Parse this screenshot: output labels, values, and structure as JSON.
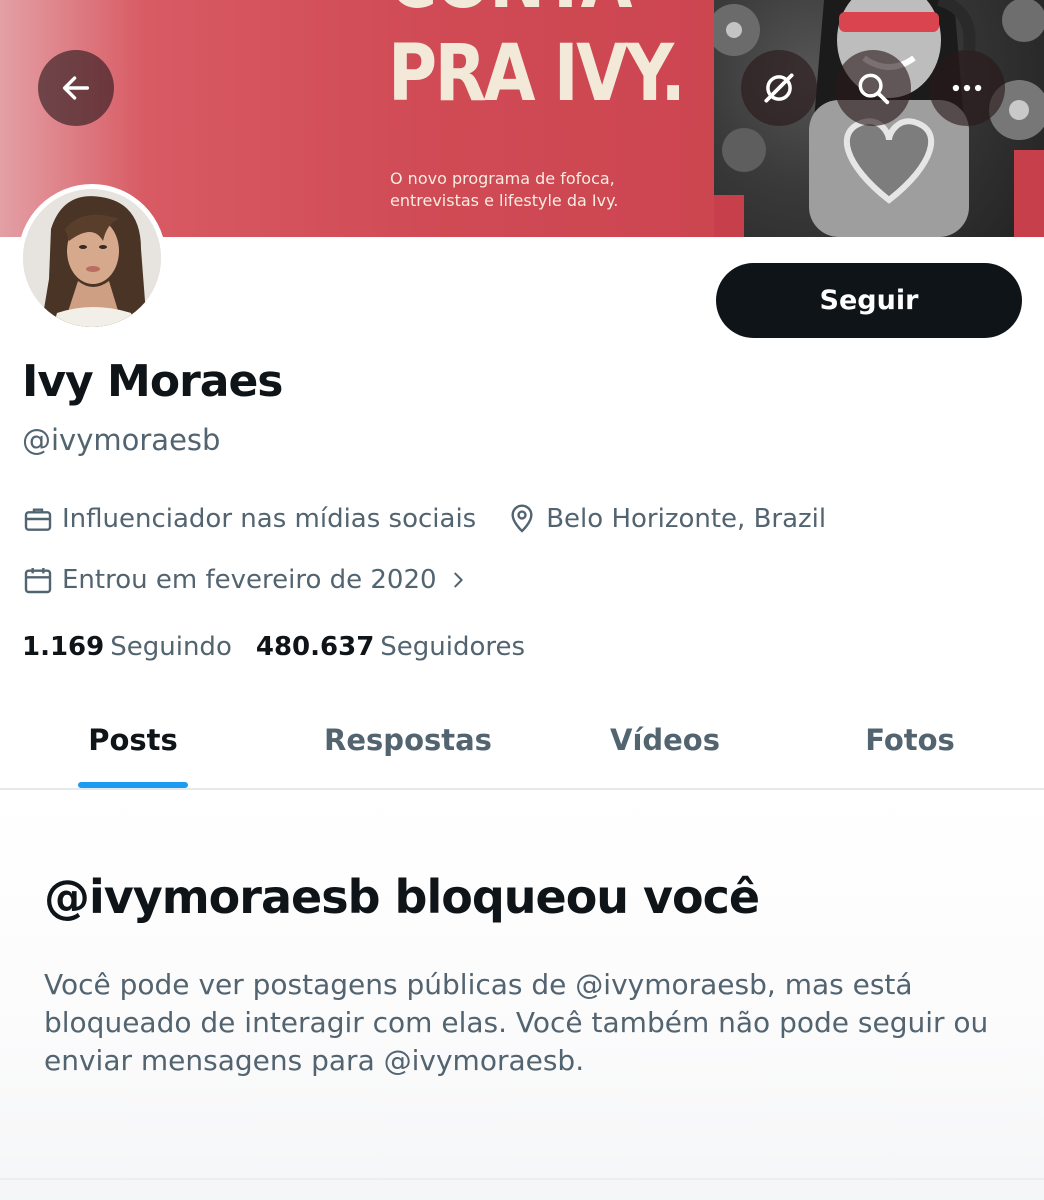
{
  "banner": {
    "headline_top": "CONTA",
    "headline_main": "PRA IVY.",
    "subtitle": "O novo programa de fofoca, entrevistas e lifestyle da Ivy."
  },
  "top_actions": {
    "back_icon": "arrow-left-icon",
    "grok_icon": "grok-icon",
    "search_icon": "search-icon",
    "more_icon": "more-horizontal-icon"
  },
  "profile": {
    "display_name": "Ivy Moraes",
    "handle": "@ivymoraesb",
    "follow_label": "Seguir",
    "profession": "Influenciador nas mídias sociais",
    "location": "Belo Horizonte, Brazil",
    "joined": "Entrou em fevereiro de 2020",
    "following_count": "1.169",
    "following_label": "Seguindo",
    "followers_count": "480.637",
    "followers_label": "Seguidores"
  },
  "tabs": [
    {
      "label": "Posts",
      "active": true
    },
    {
      "label": "Respostas",
      "active": false
    },
    {
      "label": "Vídeos",
      "active": false
    },
    {
      "label": "Fotos",
      "active": false
    }
  ],
  "blocked": {
    "title": "@ivymoraesb bloqueou você",
    "body": "Você pode ver postagens públicas de @ivymoraesb, mas está bloqueado de interagir com elas. Você também não pode seguir ou enviar mensagens para @ivymoraesb."
  },
  "colors": {
    "accent": "#1d9bf0",
    "text_primary": "#0f1419",
    "text_secondary": "#536471",
    "banner_red": "#cc4550"
  }
}
